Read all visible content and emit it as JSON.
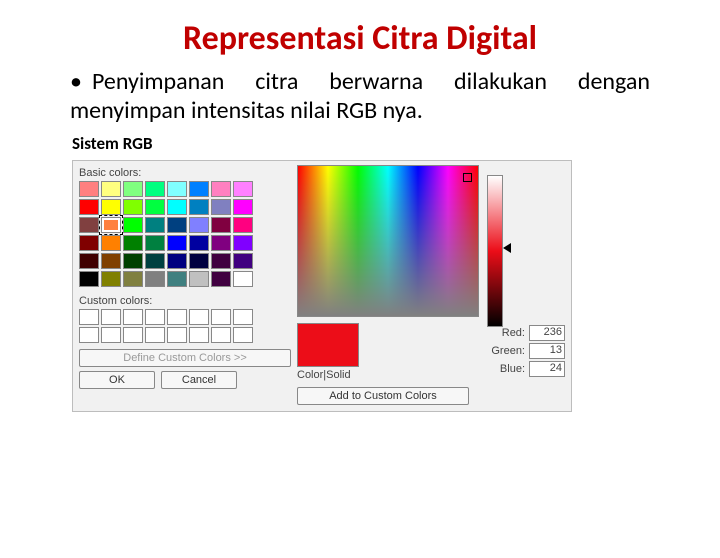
{
  "title": "Representasi Citra Digital",
  "bullet_text": "Penyimpanan citra berwarna dilakukan dengan menyimpan intensitas nilai RGB nya.",
  "rgb_heading": "Sistem RGB",
  "picker": {
    "basic_label": "Basic colors:",
    "custom_label": "Custom colors:",
    "define_btn": "Define Custom Colors >>",
    "ok_btn": "OK",
    "cancel_btn": "Cancel",
    "color_solid": "Color|Solid",
    "add_btn": "Add to Custom Colors",
    "fields": {
      "red_label": "Red:",
      "green_label": "Green:",
      "blue_label": "Blue:",
      "red": "236",
      "green": "13",
      "blue": "24"
    },
    "basic_colors": [
      "#ff8080",
      "#ffff80",
      "#80ff80",
      "#00ff80",
      "#80ffff",
      "#0080ff",
      "#ff80c0",
      "#ff80ff",
      "#ff0000",
      "#ffff00",
      "#80ff00",
      "#00ff40",
      "#00ffff",
      "#0080c0",
      "#8080c0",
      "#ff00ff",
      "#804040",
      "#ff8040",
      "#00ff00",
      "#008080",
      "#004080",
      "#8080ff",
      "#800040",
      "#ff0080",
      "#800000",
      "#ff8000",
      "#008000",
      "#008040",
      "#0000ff",
      "#0000a0",
      "#800080",
      "#8000ff",
      "#400000",
      "#804000",
      "#004000",
      "#004040",
      "#000080",
      "#000040",
      "#400040",
      "#400080",
      "#000000",
      "#808000",
      "#808040",
      "#808080",
      "#408080",
      "#c0c0c0",
      "#400040",
      "#ffffff"
    ],
    "selected_index": 17
  }
}
